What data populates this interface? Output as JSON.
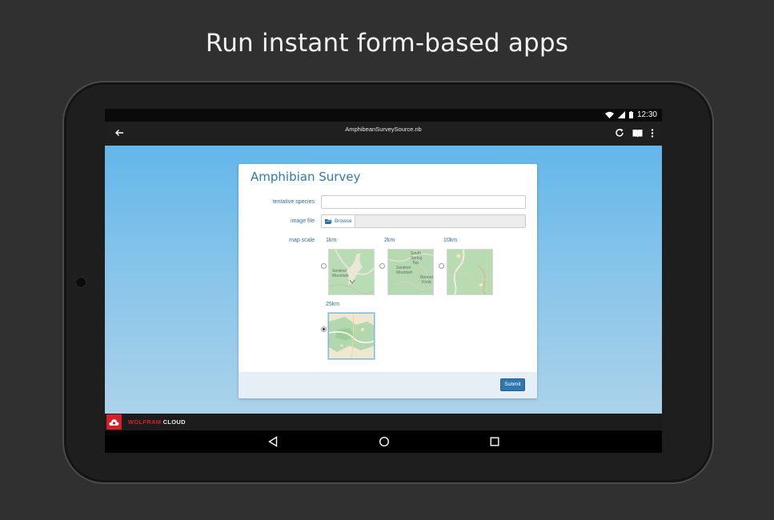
{
  "headline": "Run instant form-based apps",
  "status": {
    "time": "12:30"
  },
  "appbar": {
    "title": "AmphibeanSurveySource.nb"
  },
  "form": {
    "title": "Amphibian Survey",
    "fields": {
      "species_label": "tentative species",
      "species_value": "",
      "image_label": "image file",
      "browse_label": "Browse",
      "map_label": "map scale"
    },
    "map_options": [
      {
        "label": "1km",
        "selected": false
      },
      {
        "label": "2km",
        "selected": false
      },
      {
        "label": "10km",
        "selected": false
      },
      {
        "label": "25km",
        "selected": true
      }
    ],
    "submit_label": "Submit"
  },
  "brand": {
    "part1": "WOLFRAM",
    "part2": "CLOUD",
    "color": "#d61f26"
  },
  "colors": {
    "accent": "#2f77ad",
    "background": "#303030"
  }
}
